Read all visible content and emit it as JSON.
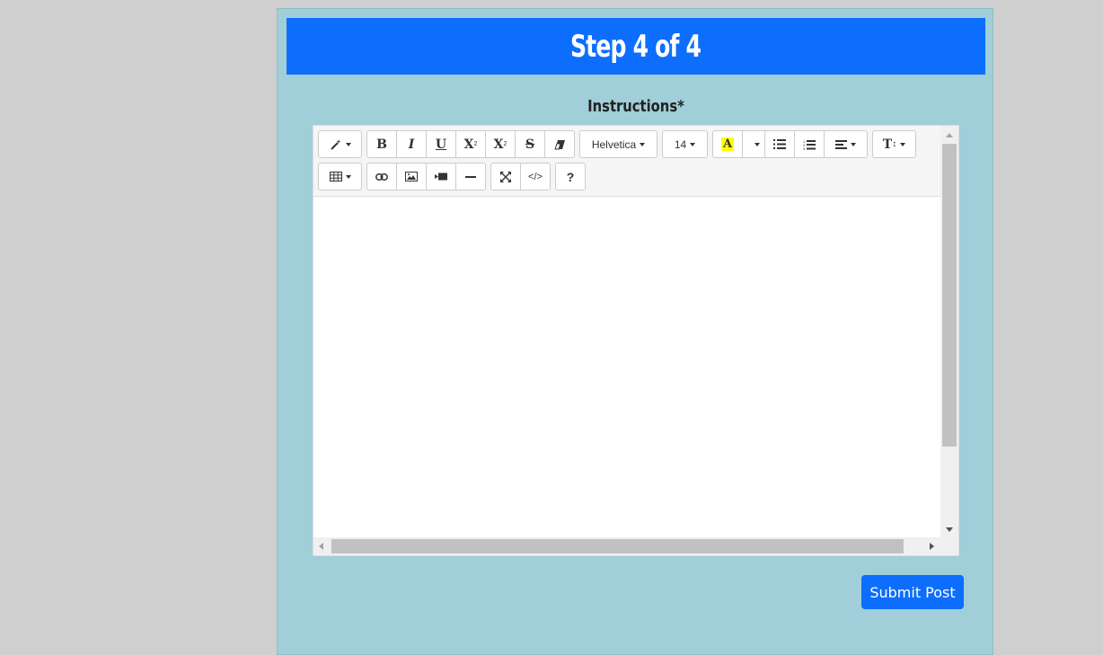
{
  "header": {
    "title": "Step 4 of 4"
  },
  "form": {
    "instructions_label": "Instructions*"
  },
  "toolbar": {
    "style_icon": "magic-icon",
    "bold": "B",
    "italic": "I",
    "underline": "U",
    "superscript": "X",
    "subscript": "X",
    "strikethrough": "S",
    "font_name": "Helvetica",
    "font_size": "14",
    "color_letter": "A",
    "color_highlight": "#ffff00",
    "height_label": "T",
    "code_view": "</>",
    "help": "?"
  },
  "editor": {
    "content": ""
  },
  "actions": {
    "submit_label": "Submit Post"
  },
  "colors": {
    "accent": "#0d6efd",
    "card_bg": "#a0ced9",
    "page_bg": "#cfcfcf"
  }
}
